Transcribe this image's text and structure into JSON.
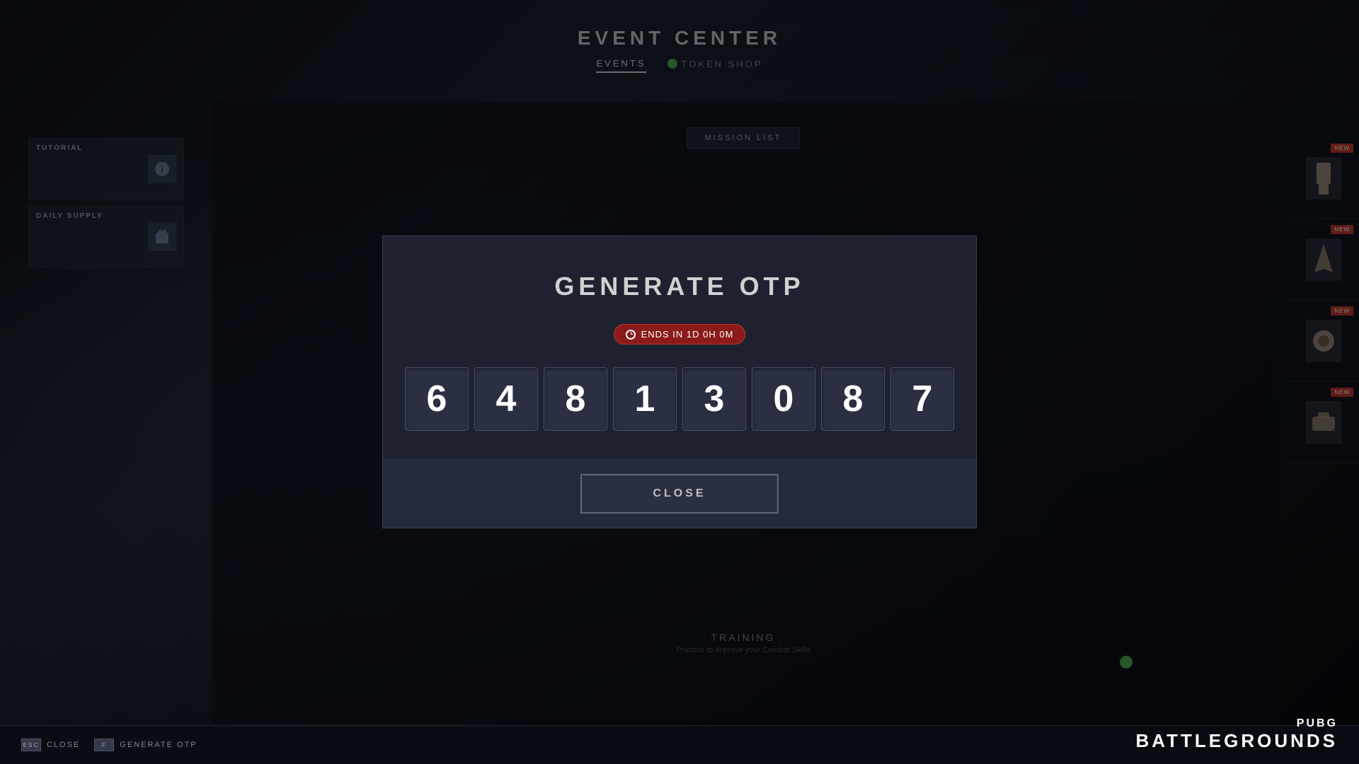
{
  "app": {
    "title": "PUBG BATTLEGROUNDS"
  },
  "header": {
    "title": "EVENT CENTER",
    "tabs": [
      {
        "id": "events",
        "label": "EVENTS",
        "active": true
      },
      {
        "id": "token-shop",
        "label": "TOKEN SHOP",
        "active": false
      }
    ]
  },
  "sidebar_left": {
    "cards": [
      {
        "id": "tutorial",
        "label": "TUTORIAL"
      },
      {
        "id": "daily-supply",
        "label": "DAILY SUPPLY"
      }
    ]
  },
  "sidebar_right": {
    "items": [
      {
        "id": "item-1",
        "badge": "NEW"
      },
      {
        "id": "item-2",
        "badge": "NEW"
      },
      {
        "id": "item-3",
        "badge": "NEW"
      },
      {
        "id": "item-4",
        "badge": "NEW"
      }
    ]
  },
  "main_content": {
    "mission_list_label": "MISSION LIST",
    "training": {
      "label": "TRAINING",
      "sublabel": "Practice to improve your Combat Skills"
    }
  },
  "dialog": {
    "title": "GENERATE OTP",
    "timer": {
      "label": "ENDS IN 1d 0h 0m",
      "icon": "clock"
    },
    "otp_digits": [
      "6",
      "4",
      "8",
      "1",
      "3",
      "0",
      "8",
      "7"
    ],
    "close_button": "CLOSE"
  },
  "bottom_bar": {
    "buttons": [
      {
        "id": "close-btn",
        "label": "CLOSE"
      },
      {
        "id": "generate-otp-btn",
        "label": "GENERATE OTP"
      }
    ]
  },
  "pubg_logo": {
    "line1": "PUBG",
    "line2": "BATTLEGROUNDS"
  }
}
